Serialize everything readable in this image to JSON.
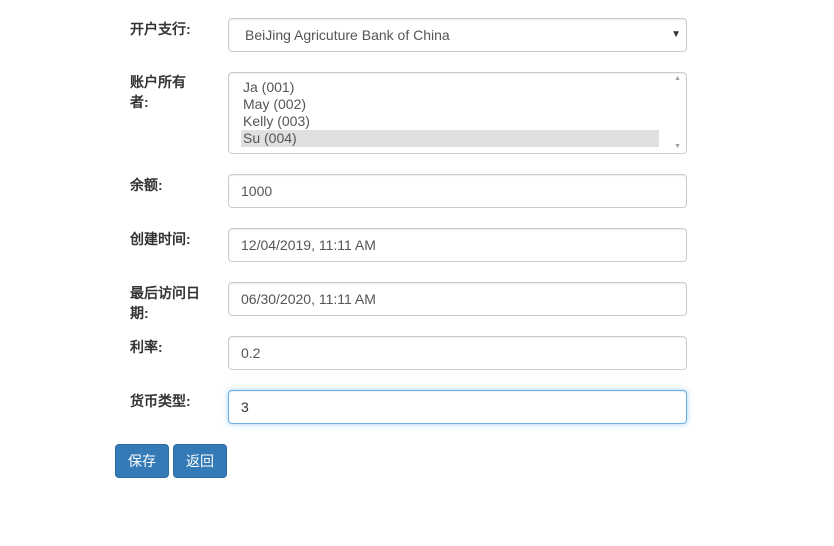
{
  "form": {
    "branch": {
      "label": "开户支行:",
      "value": "BeiJing Agricuture Bank of China"
    },
    "owners": {
      "label": "账户所有者:",
      "options": [
        "Ja (001)",
        "May (002)",
        "Kelly (003)",
        "Su (004)"
      ],
      "selected": "Su (004)"
    },
    "balance": {
      "label": "余额:",
      "value": "1000"
    },
    "created_time": {
      "label": "创建时间:",
      "value": "12/04/2019, 11:11  AM"
    },
    "last_access_date": {
      "label": "最后访问日期:",
      "value": "06/30/2020, 11:11  AM"
    },
    "interest_rate": {
      "label": "利率:",
      "value": "0.2"
    },
    "currency_type": {
      "label": "货币类型:",
      "value": "3"
    }
  },
  "actions": {
    "save_label": "保存",
    "back_label": "返回"
  },
  "colors": {
    "primary": "#337ab7",
    "focus_border": "#66afe9",
    "selected_option": "#e0e0e0"
  },
  "icons": {
    "select_arrow": "chevron-down-icon",
    "scroll_up": "scroll-up-arrow-icon",
    "scroll_down": "scroll-down-arrow-icon"
  }
}
